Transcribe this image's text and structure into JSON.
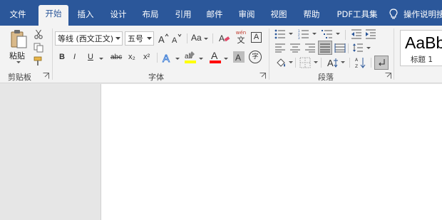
{
  "tabs": [
    {
      "label": "文件"
    },
    {
      "label": "开始"
    },
    {
      "label": "插入"
    },
    {
      "label": "设计"
    },
    {
      "label": "布局"
    },
    {
      "label": "引用"
    },
    {
      "label": "邮件"
    },
    {
      "label": "审阅"
    },
    {
      "label": "视图"
    },
    {
      "label": "帮助"
    },
    {
      "label": "PDF工具集"
    }
  ],
  "active_tab": "开始",
  "tell_me": {
    "label": "操作说明搜",
    "icon": "lightbulb-icon"
  },
  "clipboard": {
    "paste_label": "粘贴",
    "group_label": "剪贴板",
    "icons": [
      "paste-icon",
      "cut-icon",
      "copy-icon",
      "format-painter-icon"
    ]
  },
  "font": {
    "group_label": "字体",
    "font_name": "等线 (西文正文)",
    "font_size": "五号",
    "bold": "B",
    "italic": "I",
    "underline": "U",
    "strikethrough": "abc",
    "subscript": "x₂",
    "superscript": "x²",
    "change_case": "Aa",
    "phonetic_guide": "wén",
    "phonetic_char": "文",
    "char_border": "A",
    "enclose_char": "字",
    "highlight_color": "#ffff00",
    "font_color": "#ff0000",
    "icons": [
      "grow-font-icon",
      "shrink-font-icon",
      "clear-formatting-icon",
      "text-effects-icon",
      "highlight-icon",
      "font-color-icon",
      "char-shading-icon"
    ]
  },
  "paragraph": {
    "group_label": "段落",
    "icons": [
      "bullets-icon",
      "numbering-icon",
      "multilevel-list-icon",
      "decrease-indent-icon",
      "increase-indent-icon",
      "align-left-icon",
      "align-center-icon",
      "align-right-icon",
      "justify-icon",
      "distributed-icon",
      "line-spacing-icon",
      "shading-icon",
      "borders-icon",
      "chinese-layout-icon",
      "sort-icon",
      "show-marks-icon"
    ]
  },
  "styles": {
    "sample_text": "AaBb",
    "style_name": "标题 1"
  },
  "colors": {
    "tabbar_bg": "#2b579a",
    "ribbon_bg": "#f3f3f3",
    "canvas_bg": "#e6e6e6",
    "page_bg": "#ffffff",
    "accent": "#2b579a"
  }
}
